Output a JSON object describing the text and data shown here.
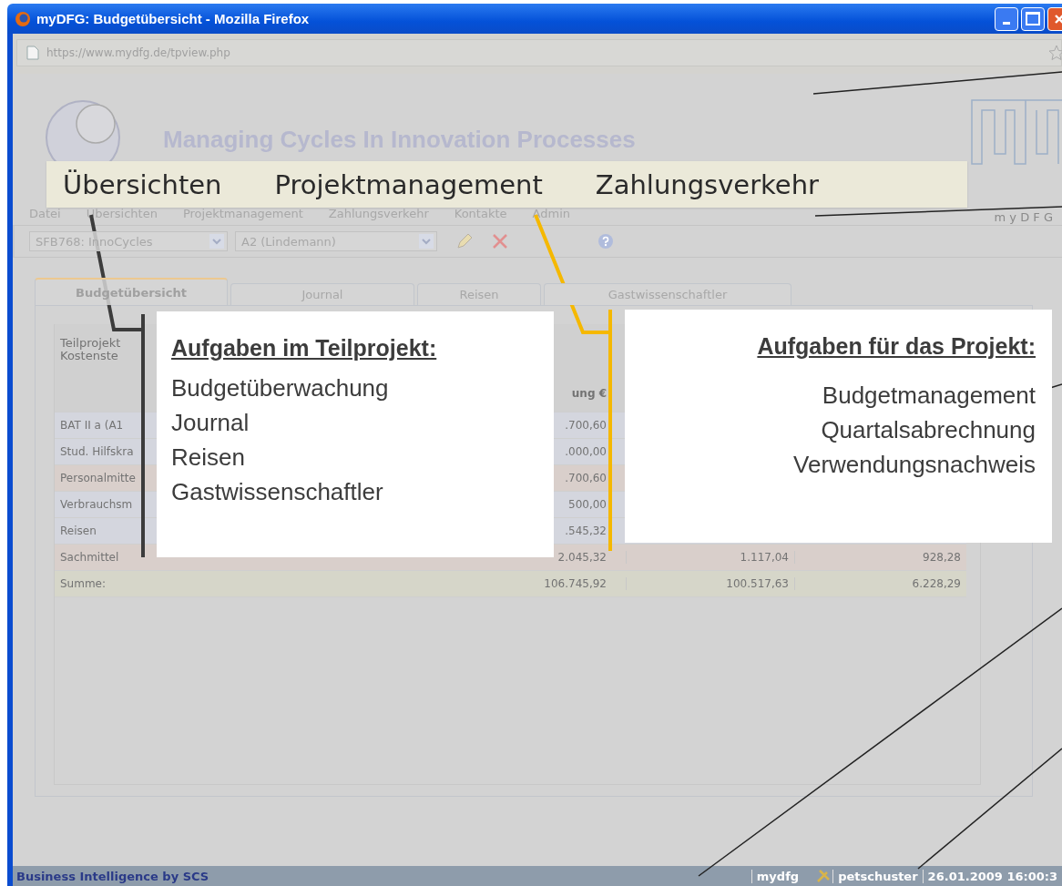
{
  "window": {
    "title": "myDFG: Budgetübersicht - Mozilla Firefox"
  },
  "address_bar": {
    "url": "https://www.mydfg.de/tpview.php"
  },
  "header": {
    "title": "Managing Cycles In Innovation Processes"
  },
  "menu": [
    {
      "label": "Datei"
    },
    {
      "label": "Übersichten"
    },
    {
      "label": "Projektmanagement"
    },
    {
      "label": "Zahlungsverkehr"
    },
    {
      "label": "Kontakte"
    },
    {
      "label": "Admin"
    }
  ],
  "menu_brand": "m y D F G",
  "toolbar": {
    "selects": [
      "SFB768: InnoCycles",
      "A2 (Lindemann)"
    ]
  },
  "tabs": [
    {
      "label": "Budgetübersicht",
      "selected": true
    },
    {
      "label": "Journal",
      "selected": false
    },
    {
      "label": "Reisen",
      "selected": false
    },
    {
      "label": "Gastwissenschaftler",
      "selected": false
    }
  ],
  "table": {
    "info": [
      "Teilprojekt",
      "Kostenste"
    ],
    "header_cell": "ung €",
    "rows": [
      {
        "label": "BAT II a (A1",
        "values": [
          ".700,60"
        ],
        "kind": "item"
      },
      {
        "label": "Stud. Hilfskra",
        "values": [
          ".000,00"
        ],
        "kind": "item"
      },
      {
        "label": "Personalmitte",
        "values": [
          ".700,60"
        ],
        "kind": "subtotal"
      },
      {
        "label": "Verbrauchsm",
        "values": [
          "500,00"
        ],
        "kind": "item"
      },
      {
        "label": "Reisen",
        "values": [
          ".545,32"
        ],
        "kind": "item"
      },
      {
        "label": "Sachmittel",
        "values": [
          "2.045,32",
          "1.117,04",
          "928,28"
        ],
        "kind": "subtotal"
      },
      {
        "label": "Summe:",
        "values": [
          "106.745,92",
          "100.517,63",
          "6.228,29"
        ],
        "kind": "total"
      }
    ]
  },
  "zoomed_menu": [
    "Übersichten",
    "Projektmanagement",
    "Zahlungsverkehr"
  ],
  "callouts": [
    {
      "heading": "Aufgaben im Teilprojekt:",
      "items": [
        "Budgetüberwachung",
        "Journal",
        "Reisen",
        "Gastwissenschaftler"
      ],
      "kind": "subproject"
    },
    {
      "heading": "Aufgaben für das Projekt:",
      "items": [
        "Budgetmanagement",
        "Quartalsabrechnung",
        "Verwendungsnachweis"
      ],
      "kind": "project"
    }
  ],
  "status_bar": {
    "text": "Business Intelligence by SCS",
    "app": "mydfg",
    "user": "petschuster",
    "datetime": "26.01.2009 16:00:3"
  }
}
